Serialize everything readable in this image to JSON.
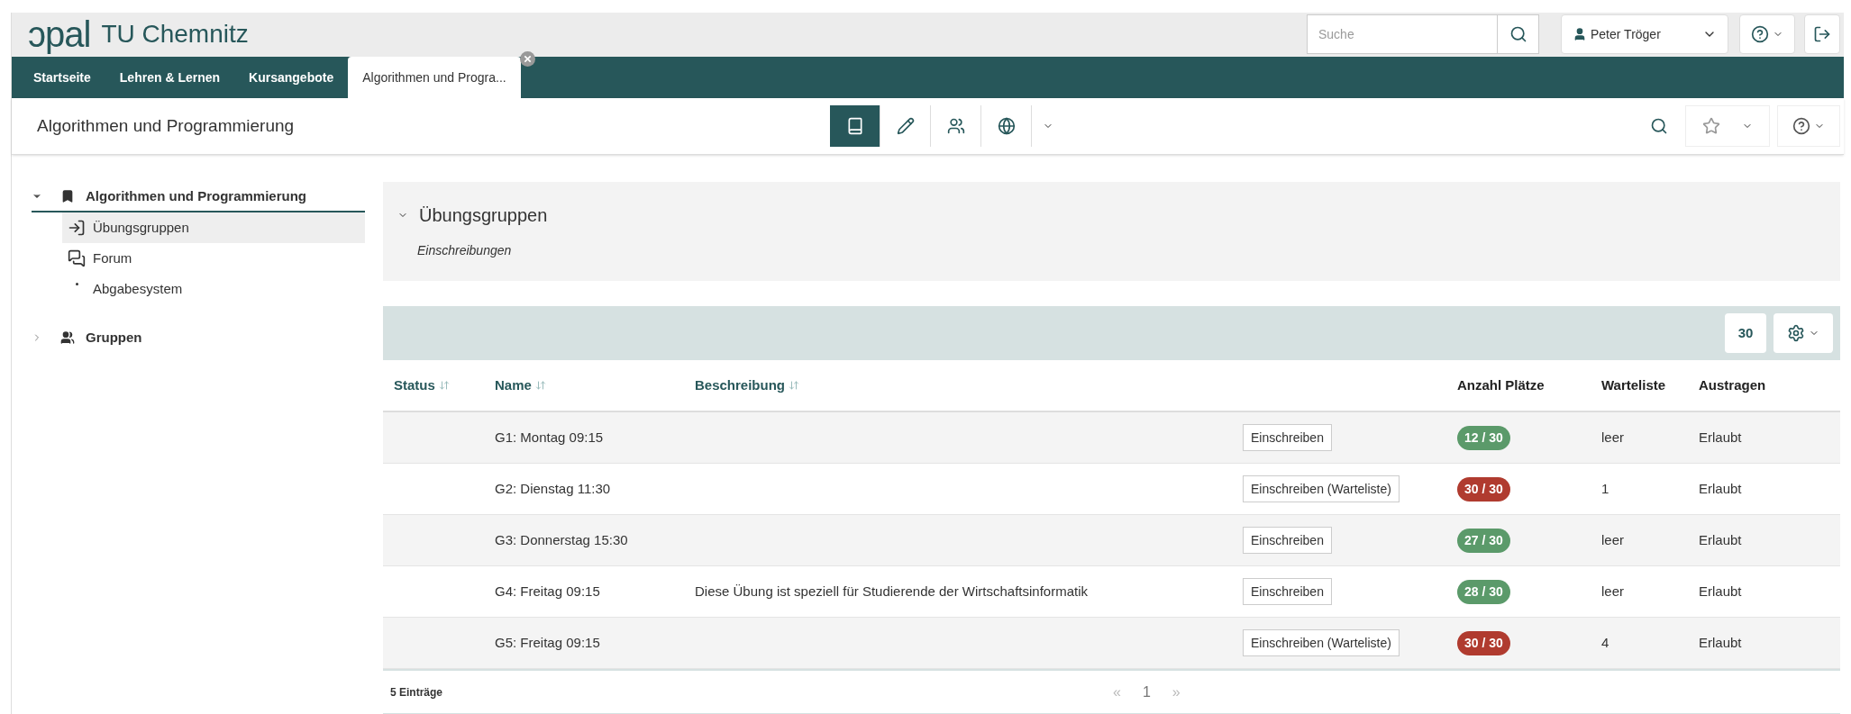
{
  "header": {
    "logo": "ɔpal",
    "site": "TU Chemnitz",
    "search": {
      "placeholder": "Suche"
    },
    "user": "Peter Tröger"
  },
  "nav_tabs": [
    {
      "label": "Startseite",
      "selected": false,
      "closable": false
    },
    {
      "label": "Lehren & Lernen",
      "selected": false,
      "closable": false
    },
    {
      "label": "Kursangebote",
      "selected": false,
      "closable": false
    },
    {
      "label": "Algorithmen und Progra...",
      "selected": true,
      "closable": true
    }
  ],
  "course": {
    "title": "Algorithmen und Programmierung",
    "tools": [
      {
        "kind": "book",
        "selected": true
      },
      {
        "kind": "edit",
        "selected": false
      },
      {
        "kind": "users",
        "selected": false
      },
      {
        "kind": "globe",
        "selected": false
      }
    ]
  },
  "sidebar": {
    "items": [
      {
        "label": "Algorithmen und Programmierung",
        "kind": "course",
        "expanded": true,
        "selected": false,
        "children": [
          {
            "label": "Übungsgruppen",
            "kind": "enroll",
            "selected": true
          },
          {
            "label": "Forum",
            "kind": "forum",
            "selected": false
          },
          {
            "label": "Abgabesystem",
            "kind": "task",
            "selected": false
          }
        ]
      },
      {
        "label": "Gruppen",
        "kind": "groups",
        "expanded": false,
        "selected": false
      }
    ]
  },
  "panel": {
    "title": "Übungsgruppen",
    "expanded": true,
    "subtitle": "Einschreibungen"
  },
  "table": {
    "page_size": "30",
    "columns": [
      {
        "label": "Status",
        "sortable": true
      },
      {
        "label": "Name",
        "sortable": true
      },
      {
        "label": "Beschreibung",
        "sortable": true
      },
      {
        "label": "Anzahl Plätze",
        "sortable": false
      },
      {
        "label": "Warteliste",
        "sortable": false
      },
      {
        "label": "Austragen",
        "sortable": false
      }
    ],
    "rows": [
      {
        "name": "G1: Montag 09:15",
        "description": "",
        "action": "Einschreiben",
        "places": "12 / 30",
        "color": "#5b9a6a",
        "waitlist": "leer",
        "unsubscribe": "Erlaubt"
      },
      {
        "name": "G2: Dienstag 11:30",
        "description": "",
        "action": "Einschreiben (Warteliste)",
        "places": "30 / 30",
        "color": "#b03b2f",
        "waitlist": "1",
        "unsubscribe": "Erlaubt"
      },
      {
        "name": "G3: Donnerstag 15:30",
        "description": "",
        "action": "Einschreiben",
        "places": "27 / 30",
        "color": "#5b9a6a",
        "waitlist": "leer",
        "unsubscribe": "Erlaubt"
      },
      {
        "name": "G4: Freitag 09:15",
        "description": "Diese Übung ist speziell für Studierende der Wirtschaftsinformatik",
        "action": "Einschreiben",
        "places": "28 / 30",
        "color": "#5b9a6a",
        "waitlist": "leer",
        "unsubscribe": "Erlaubt"
      },
      {
        "name": "G5: Freitag 09:15",
        "description": "",
        "action": "Einschreiben (Warteliste)",
        "places": "30 / 30",
        "color": "#b03b2f",
        "waitlist": "4",
        "unsubscribe": "Erlaubt"
      }
    ],
    "footer": "5 Einträge",
    "pagination": [
      {
        "label": "«",
        "selected": false
      },
      {
        "label": "1",
        "selected": true
      },
      {
        "label": "»",
        "selected": false
      }
    ]
  }
}
